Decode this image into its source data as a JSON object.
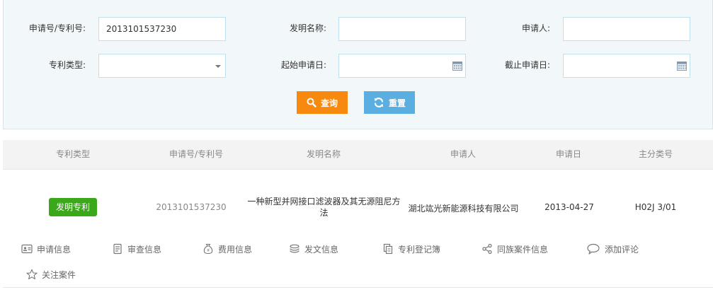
{
  "search": {
    "app_no_label": "申请号/专利号:",
    "app_no_value": "2013101537230",
    "invention_name_label": "发明名称:",
    "invention_name_value": "",
    "applicant_label": "申请人:",
    "applicant_value": "",
    "patent_type_label": "专利类型:",
    "patent_type_value": "",
    "start_date_label": "起始申请日:",
    "start_date_value": "",
    "end_date_label": "截止申请日:",
    "end_date_value": "",
    "query_label": "查询",
    "reset_label": "重置"
  },
  "table": {
    "headers": [
      "专利类型",
      "申请号/专利号",
      "发明名称",
      "申请人",
      "申请日",
      "主分类号"
    ],
    "rows": [
      {
        "type": "发明专利",
        "app_no": "2013101537230",
        "title": "一种新型并网接口滤波器及其无源阻尼方法",
        "applicant": "湖北竑光新能源科技有限公司",
        "date": "2013-04-27",
        "ipc": "H02J 3/01"
      }
    ]
  },
  "actions": [
    {
      "label": "申请信息",
      "icon": "id-card-icon"
    },
    {
      "label": "审查信息",
      "icon": "document-icon"
    },
    {
      "label": "费用信息",
      "icon": "money-bag-icon"
    },
    {
      "label": "发文信息",
      "icon": "stack-icon"
    },
    {
      "label": "专利登记簿",
      "icon": "copy-icon"
    },
    {
      "label": "同族案件信息",
      "icon": "share-icon"
    },
    {
      "label": "添加评论",
      "icon": "comment-icon"
    },
    {
      "label": "关注案件",
      "icon": "star-icon"
    }
  ],
  "colors": {
    "query_button": "#f7890e",
    "reset_button": "#5aaee0",
    "invention_badge": "#3aa81a",
    "panel_bg": "#f2f7f9",
    "input_border": "#bfe0ee"
  }
}
